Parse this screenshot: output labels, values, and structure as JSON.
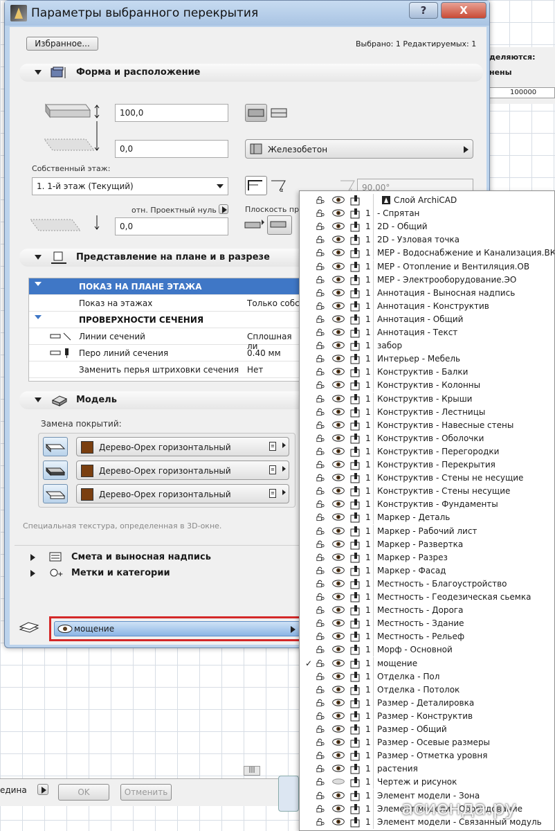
{
  "background": {
    "panel_lines": [
      "деляются:",
      "нены"
    ],
    "ruler_text": "100000"
  },
  "dialog": {
    "title": "Параметры выбранного перекрытия",
    "help_label": "?",
    "close_label": "X",
    "favorites_label": "Избранное...",
    "selection_info": "Выбрано: 1 Редактируемых: 1"
  },
  "shape_section": {
    "title": "Форма и расположение",
    "thickness": "100,0",
    "offset": "0,0",
    "home_story_label": "Собственный этаж:",
    "home_story_value": "1. 1-й этаж (Текущий)",
    "reference_label": "отн. Проектный нуль",
    "reference_value": "0,0",
    "material": "Железобетон",
    "angle": "90,00°",
    "plane_label": "Плоскость при"
  },
  "plan_section": {
    "title": "Представление на плане и в разрезе",
    "rows": [
      {
        "type": "hdr",
        "name": "ПОКАЗ НА ПЛАНЕ ЭТАЖА",
        "value": ""
      },
      {
        "type": "item",
        "name": "Показ на этажах",
        "value": "Только собст"
      },
      {
        "type": "sub",
        "name": "ПРОВЕРХНОСТИ СЕЧЕНИЯ",
        "value": ""
      },
      {
        "type": "item",
        "name": "Линии сечений",
        "value": "Сплошная ли"
      },
      {
        "type": "item",
        "name": "Перо линий сечения",
        "value": "0.40 мм"
      },
      {
        "type": "item",
        "name": "Заменить перья штриховки сечения",
        "value": "Нет"
      }
    ]
  },
  "model_section": {
    "title": "Модель",
    "override_label": "Замена покрытий:",
    "materials": [
      "Дерево-Орех горизонтальный",
      "Дерево-Орех горизонтальный",
      "Дерево-Орех горизонтальный"
    ],
    "note": "Специальная текстура, определенная в 3D-окне."
  },
  "collapsed_sections": [
    "Смета и выносная надпись",
    "Метки и категории"
  ],
  "layer_button": {
    "label": "мощение"
  },
  "bottom_bar": {
    "left_text": "едина",
    "ok_label": "OK",
    "cancel_label": "Отменить"
  },
  "layer_list": [
    {
      "num": "",
      "name": "Слой ArchiCAD",
      "checked": false,
      "header": true
    },
    {
      "num": "1",
      "name": "- Спрятан",
      "checked": false
    },
    {
      "num": "1",
      "name": "2D - Общий",
      "checked": false
    },
    {
      "num": "1",
      "name": "2D - Узловая точка",
      "checked": false
    },
    {
      "num": "1",
      "name": "MEP - Водоснабжение и Канализация.ВК",
      "checked": false
    },
    {
      "num": "1",
      "name": "MEP - Отопление и Вентиляция.ОВ",
      "checked": false
    },
    {
      "num": "1",
      "name": "MEP - Электрооборудование.ЭО",
      "checked": false
    },
    {
      "num": "1",
      "name": "Аннотация - Выносная надпись",
      "checked": false
    },
    {
      "num": "1",
      "name": "Аннотация - Конструктив",
      "checked": false
    },
    {
      "num": "1",
      "name": "Аннотация - Общий",
      "checked": false
    },
    {
      "num": "1",
      "name": "Аннотация - Текст",
      "checked": false
    },
    {
      "num": "1",
      "name": "забор",
      "checked": false
    },
    {
      "num": "1",
      "name": "Интерьер - Мебель",
      "checked": false
    },
    {
      "num": "1",
      "name": "Конструктив - Балки",
      "checked": false
    },
    {
      "num": "1",
      "name": "Конструктив - Колонны",
      "checked": false
    },
    {
      "num": "1",
      "name": "Конструктив - Крыши",
      "checked": false
    },
    {
      "num": "1",
      "name": "Конструктив - Лестницы",
      "checked": false
    },
    {
      "num": "1",
      "name": "Конструктив - Навесные стены",
      "checked": false
    },
    {
      "num": "1",
      "name": "Конструктив - Оболочки",
      "checked": false
    },
    {
      "num": "1",
      "name": "Конструктив - Перегородки",
      "checked": false
    },
    {
      "num": "1",
      "name": "Конструктив - Перекрытия",
      "checked": false
    },
    {
      "num": "1",
      "name": "Конструктив - Стены не несущие",
      "checked": false
    },
    {
      "num": "1",
      "name": "Конструктив - Стены несущие",
      "checked": false
    },
    {
      "num": "1",
      "name": "Конструктив - Фундаменты",
      "checked": false
    },
    {
      "num": "1",
      "name": "Маркер - Деталь",
      "checked": false
    },
    {
      "num": "1",
      "name": "Маркер - Рабочий лист",
      "checked": false
    },
    {
      "num": "1",
      "name": "Маркер - Развертка",
      "checked": false
    },
    {
      "num": "1",
      "name": "Маркер - Разрез",
      "checked": false
    },
    {
      "num": "1",
      "name": "Маркер - Фасад",
      "checked": false
    },
    {
      "num": "1",
      "name": "Местность - Благоустройство",
      "checked": false
    },
    {
      "num": "1",
      "name": "Местность - Геодезическая сьемка",
      "checked": false
    },
    {
      "num": "1",
      "name": "Местность - Дорога",
      "checked": false
    },
    {
      "num": "1",
      "name": "Местность - Здание",
      "checked": false
    },
    {
      "num": "1",
      "name": "Местность - Рельеф",
      "checked": false
    },
    {
      "num": "1",
      "name": "Морф - Основной",
      "checked": false
    },
    {
      "num": "1",
      "name": "мощение",
      "checked": true
    },
    {
      "num": "1",
      "name": "Отделка - Пол",
      "checked": false
    },
    {
      "num": "1",
      "name": "Отделка - Потолок",
      "checked": false
    },
    {
      "num": "1",
      "name": "Размер - Деталировка",
      "checked": false
    },
    {
      "num": "1",
      "name": "Размер - Конструктив",
      "checked": false
    },
    {
      "num": "1",
      "name": "Размер - Общий",
      "checked": false
    },
    {
      "num": "1",
      "name": "Размер - Осевые размеры",
      "checked": false
    },
    {
      "num": "1",
      "name": "Размер - Отметка уровня",
      "checked": false
    },
    {
      "num": "1",
      "name": "растения",
      "checked": false
    },
    {
      "num": "1",
      "name": "Чертеж и рисунок",
      "checked": false,
      "hidden": true
    },
    {
      "num": "1",
      "name": "Элемент модели - Зона",
      "checked": false
    },
    {
      "num": "1",
      "name": "Элемент модели - Оборудование",
      "checked": false
    },
    {
      "num": "1",
      "name": "Элемент модели - Связанный модуль",
      "checked": false
    }
  ],
  "watermark": "асиенда.ру"
}
